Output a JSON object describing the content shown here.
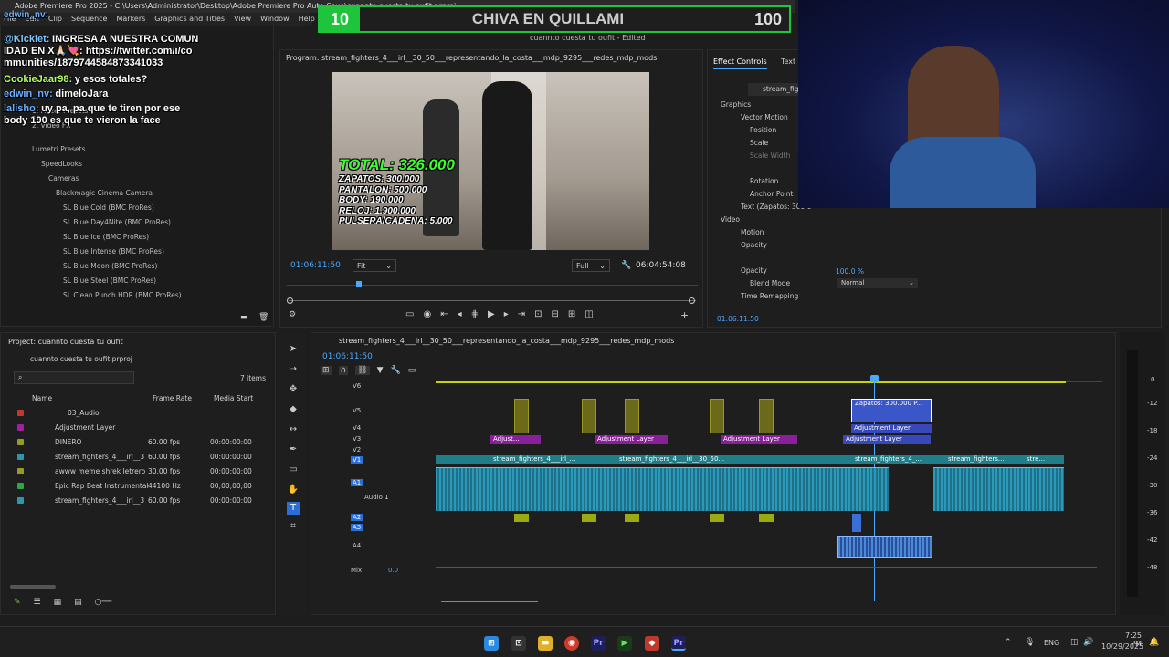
{
  "window": {
    "title": "Adobe Premiere Pro 2025 - C:\\Users\\Administrator\\Desktop\\Adobe Premiere Pro Auto-Save\\cuannto cuesta tu oufit.prproj",
    "edited_label": "cuannto cuesta tu oufit - Edited"
  },
  "menu": [
    "File",
    "Edit",
    "Clip",
    "Sequence",
    "Markers",
    "Graphics and Titles",
    "View",
    "Window",
    "Help"
  ],
  "goal_bar": {
    "number": "10",
    "name": "CHIVA EN QUILLAMI",
    "goal": "100",
    "progress": 0.1,
    "color": "#1ec43b"
  },
  "chat": [
    {
      "user": "@Kickiet:",
      "text": "INGRESA A NUESTRA COMUNIDAD EN X🙏🏻💘: https://twitter.com/i/communities/1879744584873341033"
    },
    {
      "user": "CookieJaar98:",
      "text": "y esos totales?"
    },
    {
      "user": "edwin_nv:",
      "text": "dimeloJara"
    },
    {
      "user": "lalisho:",
      "text": "uy pa, pa que te tiren por ese body 190 es que te vieron la face"
    }
  ],
  "chat_overlay_user": "edwin_nv:",
  "effects_tree": [
    "1. Finzer Presets",
    "2. Video FX",
    "Lumetri Presets",
    "SpeedLooks",
    "Cameras",
    "Blackmagic Cinema Camera",
    "SL Blue Cold (BMC ProRes)",
    "SL Blue Day4Nite (BMC ProRes)",
    "SL Blue Ice (BMC ProRes)",
    "SL Blue Intense (BMC ProRes)",
    "SL Blue Moon (BMC ProRes)",
    "SL Blue Steel (BMC ProRes)",
    "SL Clean Punch HDR (BMC ProRes)"
  ],
  "program": {
    "title": "Program: stream_fighters_4___irl__30_50___representando_la_costa___mdp_9295___redes_mdp_mods",
    "timecode": "01:06:11:50",
    "fit": "Fit",
    "quality": "Full",
    "duration": "06:04:54:08",
    "overlay": {
      "total": "TOTAL: 326.000",
      "lines": [
        "ZAPATOS: 300.000",
        "PANTALON: 500.000",
        "BODY: 190.000",
        "RELOJ: 1.900.000",
        "PULSERA/CADENA: 5.000"
      ]
    }
  },
  "effect_controls": {
    "tabs": [
      "Effect Controls",
      "Text"
    ],
    "clip_label": "stream_figh",
    "rows": [
      "Graphics",
      "Vector Motion",
      "Position",
      "Scale",
      "Scale Width",
      "Rotation",
      "Anchor Point",
      "Text (Zapatos: 300.0",
      "Video",
      "Motion",
      "Opacity",
      "Opacity",
      "Blend Mode",
      "Time Remapping"
    ],
    "opacity_value": "100.0 %",
    "blend_mode": "Normal",
    "timecode": "01:06:11:50"
  },
  "project": {
    "title": "Project: cuannto cuesta tu oufit",
    "file": "cuannto cuesta tu oufit.prproj",
    "count": "7 items",
    "headers": [
      "Name",
      "Frame Rate",
      "Media Start"
    ],
    "rows": [
      {
        "name": "03_Audio",
        "rate": "",
        "start": "",
        "color": "#c0392b"
      },
      {
        "name": "Adjustment Layer",
        "rate": "",
        "start": "",
        "color": "#a020a0"
      },
      {
        "name": "DINERO",
        "rate": "60.00 fps",
        "start": "00:00:00:00",
        "color": "#9a9a22"
      },
      {
        "name": "stream_fighters_4___irl__3",
        "rate": "60.00 fps",
        "start": "00:00:00:00",
        "color": "#2a9aa8"
      },
      {
        "name": "awww meme shrek letrero e",
        "rate": "30.00 fps",
        "start": "00:00:00:00",
        "color": "#9a9a22"
      },
      {
        "name": "Epic Rap Beat Instrumental",
        "rate": "44100 Hz",
        "start": "00;00;00;00",
        "color": "#2aa84a"
      },
      {
        "name": "stream_fighters_4___irl__3",
        "rate": "60.00 fps",
        "start": "00:00:00:00",
        "color": "#2a9aa8"
      }
    ]
  },
  "timeline": {
    "sequence": "stream_fighters_4___irl__30_50___representando_la_costa___mdp_9295___redes_mdp_mods",
    "timecode": "01:06:11:50",
    "tracks": [
      "V6",
      "V5",
      "V4",
      "V3",
      "V2",
      "V1",
      "A1",
      "A2",
      "A3",
      "A4",
      "Mix"
    ],
    "audio1_label": "Audio 1",
    "mix_value": "0.0",
    "clips": {
      "adjustment": "Adjustment Layer",
      "adjust_short": "Adjust...",
      "text_clip": "Zapatos: 300.000 P...",
      "video1": "stream_fighters_4___irl_...",
      "video2": "stream_fighters_4___irl__30_50...",
      "video3": "stream_fighters_4_...",
      "video4": "stream_fighters...",
      "video5": "stre..."
    },
    "meter_labels": [
      "0",
      "-12",
      "-18",
      "-24",
      "-30",
      "-36",
      "-42",
      "-48"
    ]
  },
  "taskbar": {
    "lang": "ENG",
    "time": "7:25 PM",
    "date": "10/29/2025"
  }
}
